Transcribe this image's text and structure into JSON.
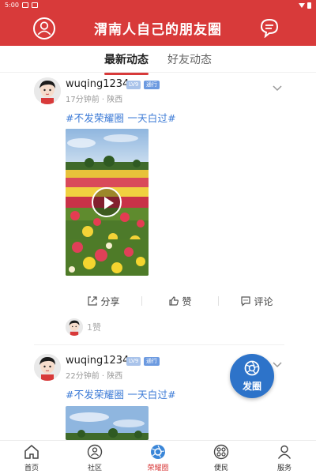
{
  "status_bar": {
    "time": "5:00"
  },
  "header": {
    "title": "渭南人自己的朋友圈"
  },
  "tabs": [
    {
      "label": "最新动态",
      "active": true
    },
    {
      "label": "好友动态",
      "active": false
    }
  ],
  "posts": [
    {
      "username": "wuqing1234",
      "level_badge": "LV9",
      "pass_badge": "通行",
      "time": "17分钟前",
      "location": "陕西",
      "hashtags": "#不发荣耀圈  一天白过#",
      "actions": {
        "share": "分享",
        "like": "赞",
        "comment": "评论"
      },
      "likes_text": "1赞"
    },
    {
      "username": "wuqing1234",
      "level_badge": "LV9",
      "pass_badge": "通行",
      "time": "22分钟前",
      "location": "陕西",
      "hashtags": "#不发荣耀圈  一天白过#"
    }
  ],
  "fab": {
    "label": "发圈"
  },
  "bottom_nav": [
    {
      "label": "首页",
      "icon": "home-icon",
      "active": false
    },
    {
      "label": "社区",
      "icon": "community-icon",
      "active": false
    },
    {
      "label": "荣耀圈",
      "icon": "honor-circle-icon",
      "active": true
    },
    {
      "label": "便民",
      "icon": "convenience-icon",
      "active": false
    },
    {
      "label": "服务",
      "icon": "service-icon",
      "active": false
    }
  ],
  "colors": {
    "brand_red": "#d83a3a",
    "link_blue": "#3b7ad6",
    "fab_blue": "#2d73c9"
  }
}
